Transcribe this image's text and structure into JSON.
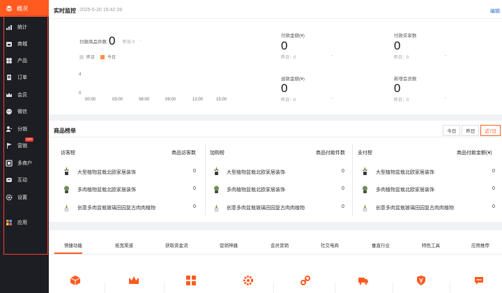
{
  "sidebar": {
    "logo_label": "概况",
    "items": [
      {
        "label": "统计",
        "icon": "bar-chart-icon",
        "hot": false
      },
      {
        "label": "商城",
        "icon": "shop-icon",
        "hot": false
      },
      {
        "label": "产品",
        "icon": "product-grid-icon",
        "hot": false
      },
      {
        "label": "订单",
        "icon": "order-icon",
        "hot": false
      },
      {
        "label": "会员",
        "icon": "crown-icon",
        "hot": false
      },
      {
        "label": "微信",
        "icon": "wechat-icon",
        "hot": false
      },
      {
        "label": "分销",
        "icon": "distribution-icon",
        "hot": false
      },
      {
        "label": "营销",
        "icon": "marketing-flag-icon",
        "hot": true
      },
      {
        "label": "多商户",
        "icon": "merchant-icon",
        "hot": false
      },
      {
        "label": "互动",
        "icon": "interact-icon",
        "hot": false
      },
      {
        "label": "设置",
        "icon": "gear-icon",
        "hot": false
      },
      {
        "label": "应用",
        "icon": "apps-icon",
        "hot": false
      }
    ],
    "hot_badge": "HOT"
  },
  "monitor": {
    "title": "实时监控",
    "time": "2025-5-20 15:42:28",
    "edit": "编辑",
    "paid_products": {
      "label": "付款商品件数",
      "value": "0",
      "yesterday": "昨日:0",
      "dash": "-"
    },
    "paid_amount": {
      "label": "付款金额(¥)",
      "value": "0",
      "yesterday": "昨日：0",
      "dash": "-"
    },
    "paid_buyers": {
      "label": "付款买家数",
      "value": "0",
      "yesterday": "昨日：0",
      "dash": "-"
    },
    "refund_amount": {
      "label": "退款金额(¥)",
      "value": "0",
      "yesterday": "昨日：0",
      "dash": "-"
    },
    "new_members": {
      "label": "新增会员数",
      "value": "0",
      "yesterday": "昨日：0",
      "dash": "-"
    },
    "legend": {
      "yesterday": "昨日",
      "today": "今日"
    },
    "colors": {
      "yesterday": "#d9d9d9",
      "today": "#ff8c42"
    }
  },
  "chart_data": {
    "type": "line",
    "x": [
      "00:00",
      "03:00",
      "06:00",
      "09:00",
      "12:00",
      "15:00"
    ],
    "y_ticks": [
      "4",
      "0"
    ],
    "series": [
      {
        "name": "昨日",
        "values": []
      },
      {
        "name": "今日",
        "values": []
      }
    ]
  },
  "ranking": {
    "title": "商品榜单",
    "tabs": [
      "今日",
      "昨日",
      "近7日"
    ],
    "active_tab": "近7日",
    "columns": [
      {
        "title": "访客榜",
        "metric": "商品访客数",
        "rows": [
          {
            "name": "大型植物盆栽北欧家居装饰",
            "value": "0"
          },
          {
            "name": "多肉植物盆栽北欧家居装饰",
            "value": "0"
          },
          {
            "name": "创意多肉盆栽玻璃田园复古肉肉植物",
            "value": "0"
          }
        ]
      },
      {
        "title": "加购榜",
        "metric": "商品付款件数",
        "rows": [
          {
            "name": "大型植物盆栽北欧家居装饰",
            "value": "0"
          },
          {
            "name": "多肉植物盆栽北欧家居装饰",
            "value": "0"
          },
          {
            "name": "创意多肉盆栽玻璃田园复古肉肉植物",
            "value": "0"
          }
        ]
      },
      {
        "title": "支付榜",
        "metric": "商品付款金额(¥)",
        "rows": [
          {
            "name": "大型植物盆栽北欧家居装饰",
            "value": "0"
          },
          {
            "name": "多肉植物盆栽北欧家居装饰",
            "value": "0"
          },
          {
            "name": "创意多肉盆栽玻璃田园复古肉肉植物",
            "value": "0"
          }
        ]
      }
    ]
  },
  "quick": {
    "tabs": [
      "快捷功能",
      "拓宽渠道",
      "获取资金流",
      "促销神器",
      "会员营销",
      "社交电商",
      "垂直行业",
      "特色工具",
      "应用推荐"
    ],
    "active_tab": "快捷功能",
    "icons": [
      "box-icon",
      "crown-icon",
      "grid-icon",
      "gear-icon",
      "link-icon",
      "truck-icon",
      "yen-shield-icon",
      "chat-icon"
    ],
    "accent": "#ff5a1f"
  }
}
